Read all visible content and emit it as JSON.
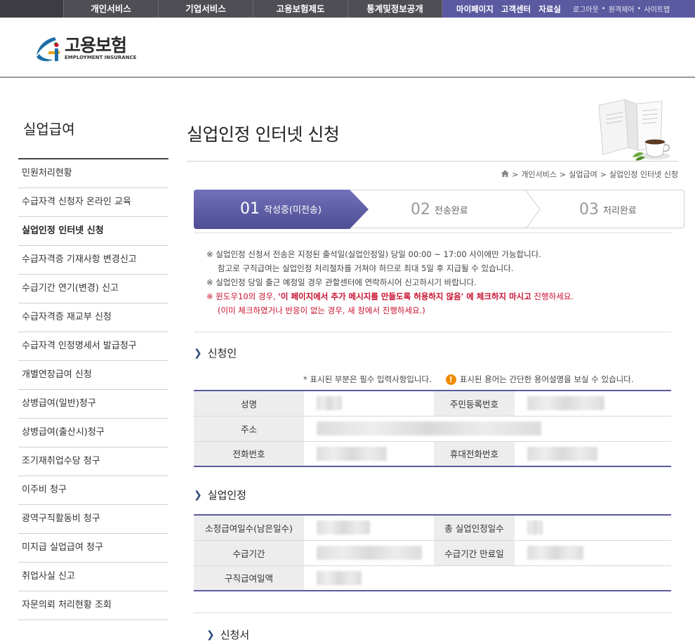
{
  "topnav": {
    "menu": [
      "개인서비스",
      "기업서비스",
      "고용보험제도",
      "통계및정보공개"
    ],
    "util_main": [
      "마이페이지",
      "고객센터",
      "자료실"
    ],
    "util_small": [
      "로그아웃",
      "원격제어",
      "사이트맵"
    ]
  },
  "logo": {
    "ko": "고용보험",
    "en": "EMPLOYMENT INSURANCE"
  },
  "sidebar": {
    "title": "실업급여",
    "items": [
      "민원처리현황",
      "수급자격 신청자 온라인 교육",
      "실업인정 인터넷 신청",
      "수급자격증 기재사항 변경신고",
      "수급기간 연기(변경) 신고",
      "수급자격증 재교부 신청",
      "수급자격 인정명세서 발급청구",
      "개별연장급여 신청",
      "상병급여(일반)청구",
      "상병급여(출산시)청구",
      "조기재취업수당 청구",
      "이주비 청구",
      "광역구직활동비 청구",
      "미지급 실업급여 청구",
      "취업사실 신고",
      "자문의뢰 처리현황 조회"
    ],
    "active_index": 2
  },
  "page": {
    "title": "실업인정 인터넷 신청"
  },
  "breadcrumb": [
    "개인서비스",
    "실업급여",
    "실업인정 인터넷 신청"
  ],
  "steps": [
    {
      "num": "01",
      "label": "작성중(미전송)"
    },
    {
      "num": "02",
      "label": "전송완료"
    },
    {
      "num": "03",
      "label": "처리완료"
    }
  ],
  "notices": {
    "line1": "※ 실업인정 신청서 전송은 지정된 출석일(실업인정일) 당일 00:00 ~ 17:00 사이에만 가능합니다.",
    "line2": "참고로 구직급여는 실업인정 처리절차를 거쳐야 하므로 최대 5일 후 지급될 수 있습니다.",
    "line3": "※ 실업인정 당일 출근 예정일 경우 관할센터에 연락하시어 신고하시기 바랍니다.",
    "line4_a": "※ 윈도우10의 경우, ",
    "line4_b": "'이 페이지에서 추가 메시지를 만들도록 허용하지 않음' 에 체크하지 마시고",
    "line4_c": " 진행하세요.",
    "line5": "(이미 체크하였거나 반응이 없는 경우, 새 창에서 진행하세요.)"
  },
  "applicant": {
    "title": "신청인",
    "legend_required": "* 표시된 부분은 필수 입력사항입니다.",
    "legend_help": "표시된 용어는 간단한 용어설명을 보실 수 있습니다.",
    "name_label": "성명",
    "rrn_label": "주민등록번호",
    "address_label": "주소",
    "phone_label": "전화번호",
    "mobile_label": "휴대전화번호"
  },
  "unemployment": {
    "title": "실업인정",
    "days_label": "소정급여일수(남은일수)",
    "total_label": "총 실업인정일수",
    "period_label": "수급기간",
    "expiry_label": "수급기간 만료일",
    "amount_label": "구직급여일액"
  },
  "application": {
    "title": "신청서"
  },
  "colors": {
    "accent": "#5b5aa0",
    "nav": "#4e4e54",
    "required_red": "#c8102e",
    "help_orange": "#f08a00"
  }
}
